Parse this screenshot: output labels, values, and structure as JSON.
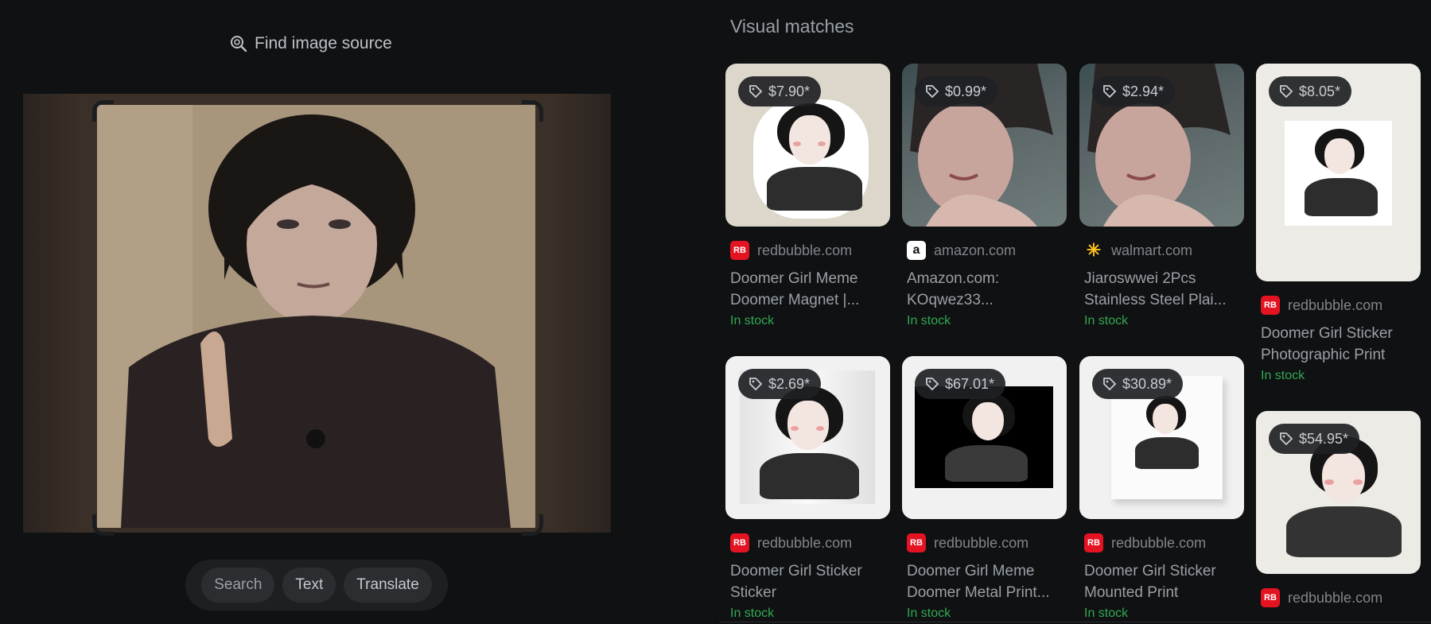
{
  "left": {
    "find_source_label": "Find image source",
    "tools": [
      "Search",
      "Text",
      "Translate"
    ]
  },
  "right": {
    "section_title": "Visual matches",
    "cards": [
      {
        "price": "$7.90*",
        "source": "redbubble.com",
        "title_lines": [
          "Doomer Girl Meme",
          "Doomer Magnet |..."
        ],
        "stock": "In stock",
        "favicon": "redbubble-icon"
      },
      {
        "price": "$0.99*",
        "source": "amazon.com",
        "title_lines": [
          "Amazon.com:",
          "KOqwez33..."
        ],
        "stock": "In stock",
        "favicon": "amazon-icon"
      },
      {
        "price": "$2.94*",
        "source": "walmart.com",
        "title_lines": [
          "Jiaroswwei 2Pcs",
          "Stainless Steel Plai..."
        ],
        "stock": "In stock",
        "favicon": "walmart-icon"
      },
      {
        "price": "$8.05*",
        "source": "redbubble.com",
        "title_lines": [
          "Doomer Girl Sticker",
          "Photographic Print"
        ],
        "stock": "In stock",
        "favicon": "redbubble-icon"
      },
      {
        "price": "$2.69*",
        "source": "redbubble.com",
        "title_lines": [
          "Doomer Girl Sticker",
          "Sticker"
        ],
        "stock": "In stock",
        "favicon": "redbubble-icon"
      },
      {
        "price": "$67.01*",
        "source": "redbubble.com",
        "title_lines": [
          "Doomer Girl Meme",
          "Doomer Metal Print..."
        ],
        "stock": "In stock",
        "favicon": "redbubble-icon"
      },
      {
        "price": "$30.89*",
        "source": "redbubble.com",
        "title_lines": [
          "Doomer Girl Sticker",
          "Mounted Print"
        ],
        "stock": "In stock",
        "favicon": "redbubble-icon"
      },
      {
        "price": "$54.95*",
        "source": "redbubble.com",
        "favicon": "redbubble-icon"
      }
    ]
  },
  "colors": {
    "background": "#0f1113",
    "in_stock": "#34a853",
    "redbubble": "#e41321",
    "walmart": "#ffc220"
  }
}
